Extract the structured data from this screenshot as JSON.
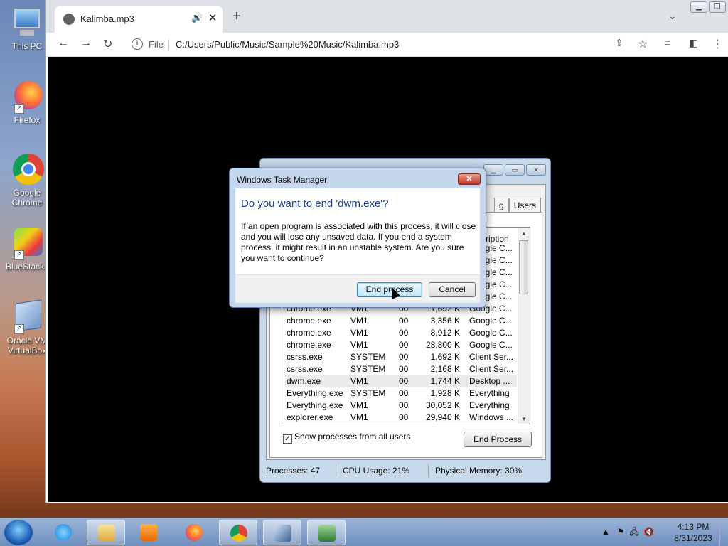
{
  "desktop": {
    "icons": [
      {
        "label": "This PC"
      },
      {
        "label": "Firefox"
      },
      {
        "label": "Google Chrome"
      },
      {
        "label": "BlueStacks"
      },
      {
        "label": "Oracle VM VirtualBox"
      }
    ]
  },
  "browser": {
    "tab_title": "Kalimba.mp3",
    "new_tab": "+",
    "omnibox_scheme": "File",
    "url": "C:/Users/Public/Music/Sample%20Music/Kalimba.mp3"
  },
  "task_manager": {
    "tabs": [
      "g",
      "Users"
    ],
    "column_header_partial": "ription",
    "processes": [
      {
        "name": "",
        "user": "",
        "cpu": "",
        "mem": "",
        "desc": "Google C..."
      },
      {
        "name": "",
        "user": "",
        "cpu": "",
        "mem": "",
        "desc": "Google C..."
      },
      {
        "name": "",
        "user": "",
        "cpu": "",
        "mem": "",
        "desc": "Google C..."
      },
      {
        "name": "",
        "user": "",
        "cpu": "",
        "mem": "",
        "desc": "Google C..."
      },
      {
        "name": "",
        "user": "",
        "cpu": "",
        "mem": "",
        "desc": "Google C..."
      },
      {
        "name": "chrome.exe",
        "user": "VM1",
        "cpu": "00",
        "mem": "11,692 K",
        "desc": "Google C..."
      },
      {
        "name": "chrome.exe",
        "user": "VM1",
        "cpu": "00",
        "mem": "3,356 K",
        "desc": "Google C..."
      },
      {
        "name": "chrome.exe",
        "user": "VM1",
        "cpu": "00",
        "mem": "8,912 K",
        "desc": "Google C..."
      },
      {
        "name": "chrome.exe",
        "user": "VM1",
        "cpu": "00",
        "mem": "28,800 K",
        "desc": "Google C..."
      },
      {
        "name": "csrss.exe",
        "user": "SYSTEM",
        "cpu": "00",
        "mem": "1,692 K",
        "desc": "Client Ser..."
      },
      {
        "name": "csrss.exe",
        "user": "SYSTEM",
        "cpu": "00",
        "mem": "2,168 K",
        "desc": "Client Ser..."
      },
      {
        "name": "dwm.exe",
        "user": "VM1",
        "cpu": "00",
        "mem": "1,744 K",
        "desc": "Desktop ..."
      },
      {
        "name": "Everything.exe",
        "user": "SYSTEM",
        "cpu": "00",
        "mem": "1,928 K",
        "desc": "Everything"
      },
      {
        "name": "Everything.exe",
        "user": "VM1",
        "cpu": "00",
        "mem": "30,052 K",
        "desc": "Everything"
      },
      {
        "name": "explorer.exe",
        "user": "VM1",
        "cpu": "00",
        "mem": "29,940 K",
        "desc": "Windows ..."
      }
    ],
    "show_all_label": "Show processes from all users",
    "show_all_checked": true,
    "end_process_label": "End Process",
    "status": {
      "processes": "Processes: 47",
      "cpu": "CPU Usage: 21%",
      "memory": "Physical Memory: 30%"
    }
  },
  "dialog": {
    "title": "Windows Task Manager",
    "question": "Do you want to end 'dwm.exe'?",
    "message": "If an open program is associated with this process, it will close and you will lose any unsaved data. If you end a system process, it might result in an unstable system. Are you sure you want to continue?",
    "confirm_label": "End process",
    "cancel_label": "Cancel"
  },
  "taskbar": {
    "time": "4:13 PM",
    "date": "8/31/2023"
  }
}
